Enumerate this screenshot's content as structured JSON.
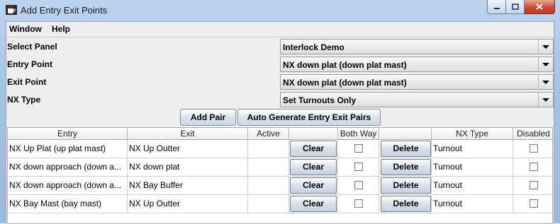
{
  "window": {
    "title": "Add Entry Exit Points"
  },
  "menu": {
    "items": [
      "Window",
      "Help"
    ]
  },
  "form": {
    "rows": [
      {
        "label": "Select Panel",
        "value": "Interlock Demo"
      },
      {
        "label": "Entry Point",
        "value": "NX down plat (down plat mast)"
      },
      {
        "label": "Exit Point",
        "value": "NX down plat (down plat mast)"
      },
      {
        "label": "NX Type",
        "value": "Set Turnouts Only"
      }
    ]
  },
  "buttons": {
    "add_pair": "Add Pair",
    "auto_generate": "Auto Generate Entry Exit Pairs"
  },
  "table": {
    "headers": [
      "Entry",
      "Exit",
      "Active",
      "",
      "Both Way",
      "",
      "NX Type",
      "Disabled"
    ],
    "rows": [
      {
        "entry": "NX Up Plat (up plat mast)",
        "exit": "NX Up Outter",
        "active": "",
        "clear": "Clear",
        "both_way": false,
        "delete": "Delete",
        "nx_type": "Turnout",
        "disabled": false
      },
      {
        "entry": "NX down approach (down a...",
        "exit": "NX down plat",
        "active": "",
        "clear": "Clear",
        "both_way": false,
        "delete": "Delete",
        "nx_type": "Turnout",
        "disabled": false
      },
      {
        "entry": "NX down approach (down a...",
        "exit": "NX Bay Buffer",
        "active": "",
        "clear": "Clear",
        "both_way": false,
        "delete": "Delete",
        "nx_type": "Turnout",
        "disabled": false
      },
      {
        "entry": "NX Bay Mast (bay mast)",
        "exit": "NX Up Outter",
        "active": "",
        "clear": "Clear",
        "both_way": false,
        "delete": "Delete",
        "nx_type": "Turnout",
        "disabled": false
      }
    ]
  },
  "icons": {
    "app": "java-cup-icon",
    "minimize": "minimize-icon",
    "maximize": "maximize-icon",
    "close": "close-icon"
  },
  "colors": {
    "titlebar": "#a8c2e4",
    "close_button": "#c84a33"
  }
}
